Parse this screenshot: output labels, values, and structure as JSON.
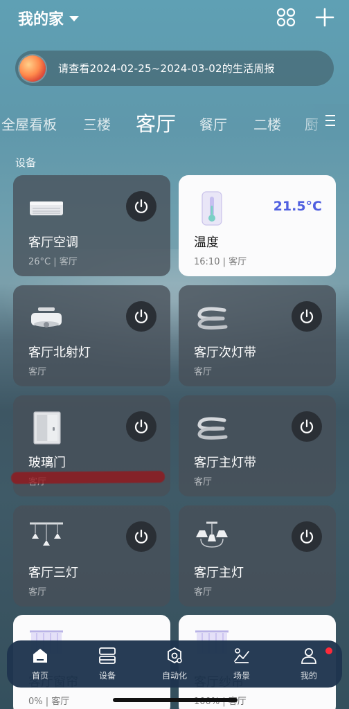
{
  "header": {
    "home_title": "我的家",
    "grid_icon": "grid-icon",
    "add_icon": "plus-icon"
  },
  "banner": {
    "text": "请查看2024-02-25~2024-03-02的生活周报"
  },
  "tabs": [
    {
      "label": "全屋看板"
    },
    {
      "label": "三楼"
    },
    {
      "label": "客厅",
      "active": true
    },
    {
      "label": "餐厅"
    },
    {
      "label": "二楼"
    },
    {
      "label": "厨"
    }
  ],
  "section": {
    "label": "设备"
  },
  "devices": [
    {
      "name": "客厅空调",
      "sub": "26°C | 客厅",
      "icon": "air-conditioner-icon"
    },
    {
      "name": "温度",
      "sub": "16:10 | 客厅",
      "value": "21.5°C",
      "icon": "thermometer-icon"
    },
    {
      "name": "客厅北射灯",
      "sub": "客厅",
      "icon": "ceiling-light-icon"
    },
    {
      "name": "客厅次灯带",
      "sub": "客厅",
      "icon": "light-strip-icon"
    },
    {
      "name": "玻璃门",
      "sub": "客厅",
      "icon": "door-icon"
    },
    {
      "name": "客厅主灯带",
      "sub": "客厅",
      "icon": "light-strip-icon"
    },
    {
      "name": "客厅三灯",
      "sub": "客厅",
      "icon": "pendant-lights-icon"
    },
    {
      "name": "客厅主灯",
      "sub": "客厅",
      "icon": "chandelier-icon"
    },
    {
      "name": "客厅窗帘",
      "sub": "0% | 客厅",
      "icon": "curtain-icon"
    },
    {
      "name": "客厅纱帘",
      "sub": "100% | 客厅",
      "icon": "curtain-icon"
    }
  ],
  "nav": [
    {
      "label": "首页",
      "icon": "home-icon"
    },
    {
      "label": "设备",
      "icon": "devices-icon"
    },
    {
      "label": "自动化",
      "icon": "automation-icon"
    },
    {
      "label": "场景",
      "icon": "scene-icon"
    },
    {
      "label": "我的",
      "icon": "profile-icon"
    }
  ],
  "colors": {
    "accent_temp": "#4f5fe0",
    "notification_dot": "#ff2a3a"
  }
}
